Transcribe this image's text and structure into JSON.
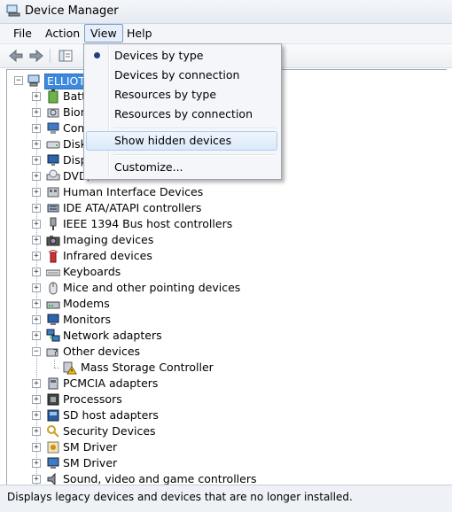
{
  "window": {
    "title": "Device Manager"
  },
  "menubar": {
    "items": [
      "File",
      "Action",
      "View",
      "Help"
    ]
  },
  "view_menu": {
    "items": [
      {
        "label": "Devices by type",
        "checked": true
      },
      {
        "label": "Devices by connection"
      },
      {
        "label": "Resources by type"
      },
      {
        "label": "Resources by connection"
      },
      {
        "label": "Show hidden devices",
        "highlighted": true
      },
      {
        "label": "Customize..."
      }
    ]
  },
  "tree": {
    "root": "ELLIOTP",
    "categories": [
      {
        "label": "Batteries",
        "icon": "battery-icon"
      },
      {
        "label": "Biometric",
        "icon": "biometric-icon"
      },
      {
        "label": "Computer",
        "icon": "computer-icon"
      },
      {
        "label": "Disk drives",
        "icon": "disk-icon"
      },
      {
        "label": "Display adapters",
        "icon": "display-icon"
      },
      {
        "label": "DVD/CD-ROM drives",
        "icon": "dvd-icon"
      },
      {
        "label": "Human Interface Devices",
        "icon": "hid-icon"
      },
      {
        "label": "IDE ATA/ATAPI controllers",
        "icon": "ide-icon"
      },
      {
        "label": "IEEE 1394 Bus host controllers",
        "icon": "ieee1394-icon"
      },
      {
        "label": "Imaging devices",
        "icon": "camera-icon"
      },
      {
        "label": "Infrared devices",
        "icon": "infrared-icon"
      },
      {
        "label": "Keyboards",
        "icon": "keyboard-icon"
      },
      {
        "label": "Mice and other pointing devices",
        "icon": "mouse-icon"
      },
      {
        "label": "Modems",
        "icon": "modem-icon"
      },
      {
        "label": "Monitors",
        "icon": "monitor-icon"
      },
      {
        "label": "Network adapters",
        "icon": "network-icon"
      },
      {
        "label": "Other devices",
        "icon": "unknown-device-icon",
        "expanded": true
      },
      {
        "label": "Mass Storage Controller",
        "icon": "warning-device-icon",
        "child": true
      },
      {
        "label": "PCMCIA adapters",
        "icon": "pcmcia-icon"
      },
      {
        "label": "Processors",
        "icon": "processor-icon"
      },
      {
        "label": "SD host adapters",
        "icon": "sd-icon"
      },
      {
        "label": "Security Devices",
        "icon": "key-icon"
      },
      {
        "label": "SM Driver",
        "icon": "driver-icon"
      },
      {
        "label": "SM Driver",
        "icon": "monitor-icon"
      },
      {
        "label": "Sound, video and game controllers",
        "icon": "sound-icon"
      }
    ]
  },
  "statusbar": {
    "text": "Displays legacy devices and devices that are no longer installed."
  },
  "colors": {
    "accent": "#3c8ade",
    "menu_highlight": "#dbe9f9",
    "radio": "#243f80"
  }
}
